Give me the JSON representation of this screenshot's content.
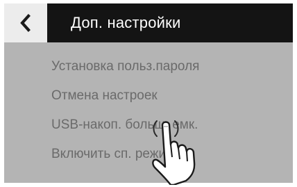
{
  "header": {
    "back_icon": "chevron-left-icon",
    "title": "Доп. настройки"
  },
  "menu": {
    "items": [
      {
        "label": "Установка польз.пароля"
      },
      {
        "label": "Отмена настроек"
      },
      {
        "label": "USB-накоп. больш. емк."
      },
      {
        "label": "Включить сп. режим"
      }
    ]
  },
  "overlay": {
    "icon": "tapping-hand-icon"
  },
  "colors": {
    "screen_bg": "#b4b4b4",
    "title_bar_bg": "#141414",
    "back_button_bg": "#ececec",
    "menu_text": "#6a6a6a"
  }
}
